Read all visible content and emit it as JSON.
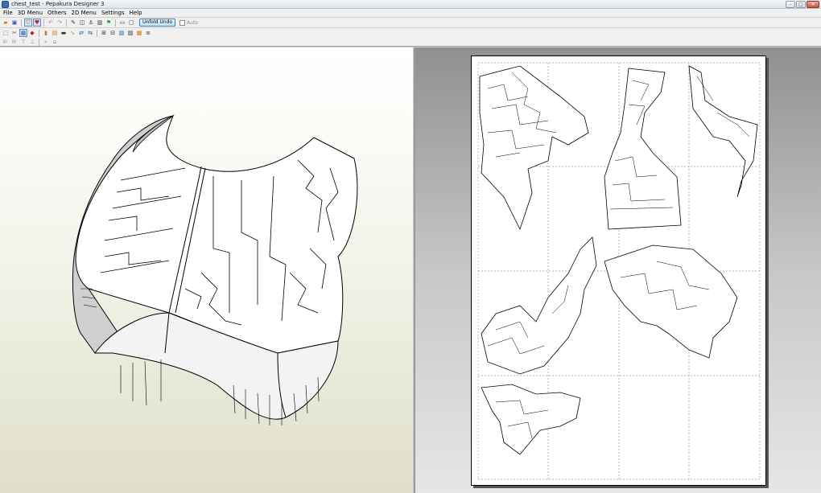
{
  "window": {
    "title": "chest_test - Pepakura Designer 3",
    "controls": [
      "–",
      "□",
      "✕"
    ]
  },
  "menu": [
    "File",
    "3D Menu",
    "Others",
    "2D Menu",
    "Settings",
    "Help"
  ],
  "toolbar": {
    "unfold_undo_label": "Unfold Undo",
    "auto_label": "Auto",
    "auto_checked": false
  },
  "icons": {
    "row1": [
      "open-folder-icon",
      "save-icon",
      "shield-icon",
      "heart-icon",
      "rotate-left-icon",
      "rotate-right-icon",
      "pencil-icon",
      "join-icon",
      "anchor-icon",
      "cylinder-icon",
      "flag-icon",
      "rectangle-icon",
      "window-icon"
    ],
    "row2": [
      "select-icon",
      "cut-icon",
      "grid-icon",
      "paint-icon",
      "texture-icon",
      "layers-icon",
      "camera-icon",
      "cursor-icon",
      "flip-icon",
      "merge-icon",
      "align-icon",
      "sort-icon",
      "fit-icon",
      "print-icon",
      "screen-icon"
    ],
    "row3": [
      "align-left-icon",
      "align-right-icon",
      "align-top-icon",
      "align-bottom-icon",
      "zoom-icon",
      "pan-icon"
    ]
  },
  "colors": {
    "titlebar": "#dfe5ee",
    "unfold_button": "#bee6fd",
    "model_fill": "#ffffff",
    "model_shadow": "#cfcfcf",
    "pane2d_bg": "#b0b0b0"
  }
}
